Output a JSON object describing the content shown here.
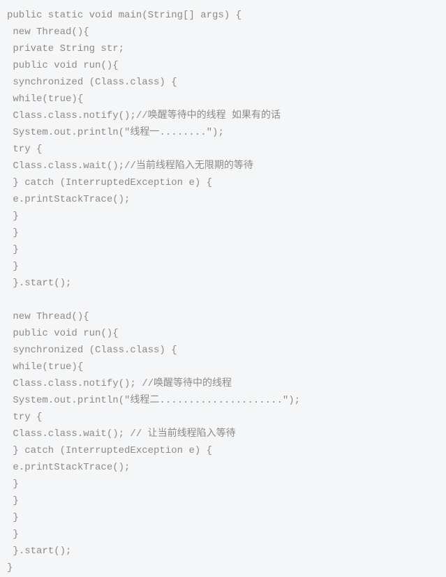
{
  "code": {
    "lines": [
      "public static void main(String[] args) {",
      " new Thread(){",
      " private String str;",
      " public void run(){",
      " synchronized (Class.class) {",
      " while(true){",
      " Class.class.notify();//唤醒等待中的线程 如果有的话",
      " System.out.println(\"线程一........\");",
      " try {",
      " Class.class.wait();//当前线程陷入无限期的等待",
      " } catch (InterruptedException e) {",
      " e.printStackTrace();",
      " }",
      " }",
      " }",
      " }",
      " }.start();",
      " ",
      " new Thread(){",
      " public void run(){",
      " synchronized (Class.class) {",
      " while(true){",
      " Class.class.notify(); //唤醒等待中的线程",
      " System.out.println(\"线程二.....................\");",
      " try {",
      " Class.class.wait(); // 让当前线程陷入等待",
      " } catch (InterruptedException e) {",
      " e.printStackTrace();",
      " }",
      " }",
      " }",
      " }",
      " }.start();",
      "}"
    ]
  }
}
